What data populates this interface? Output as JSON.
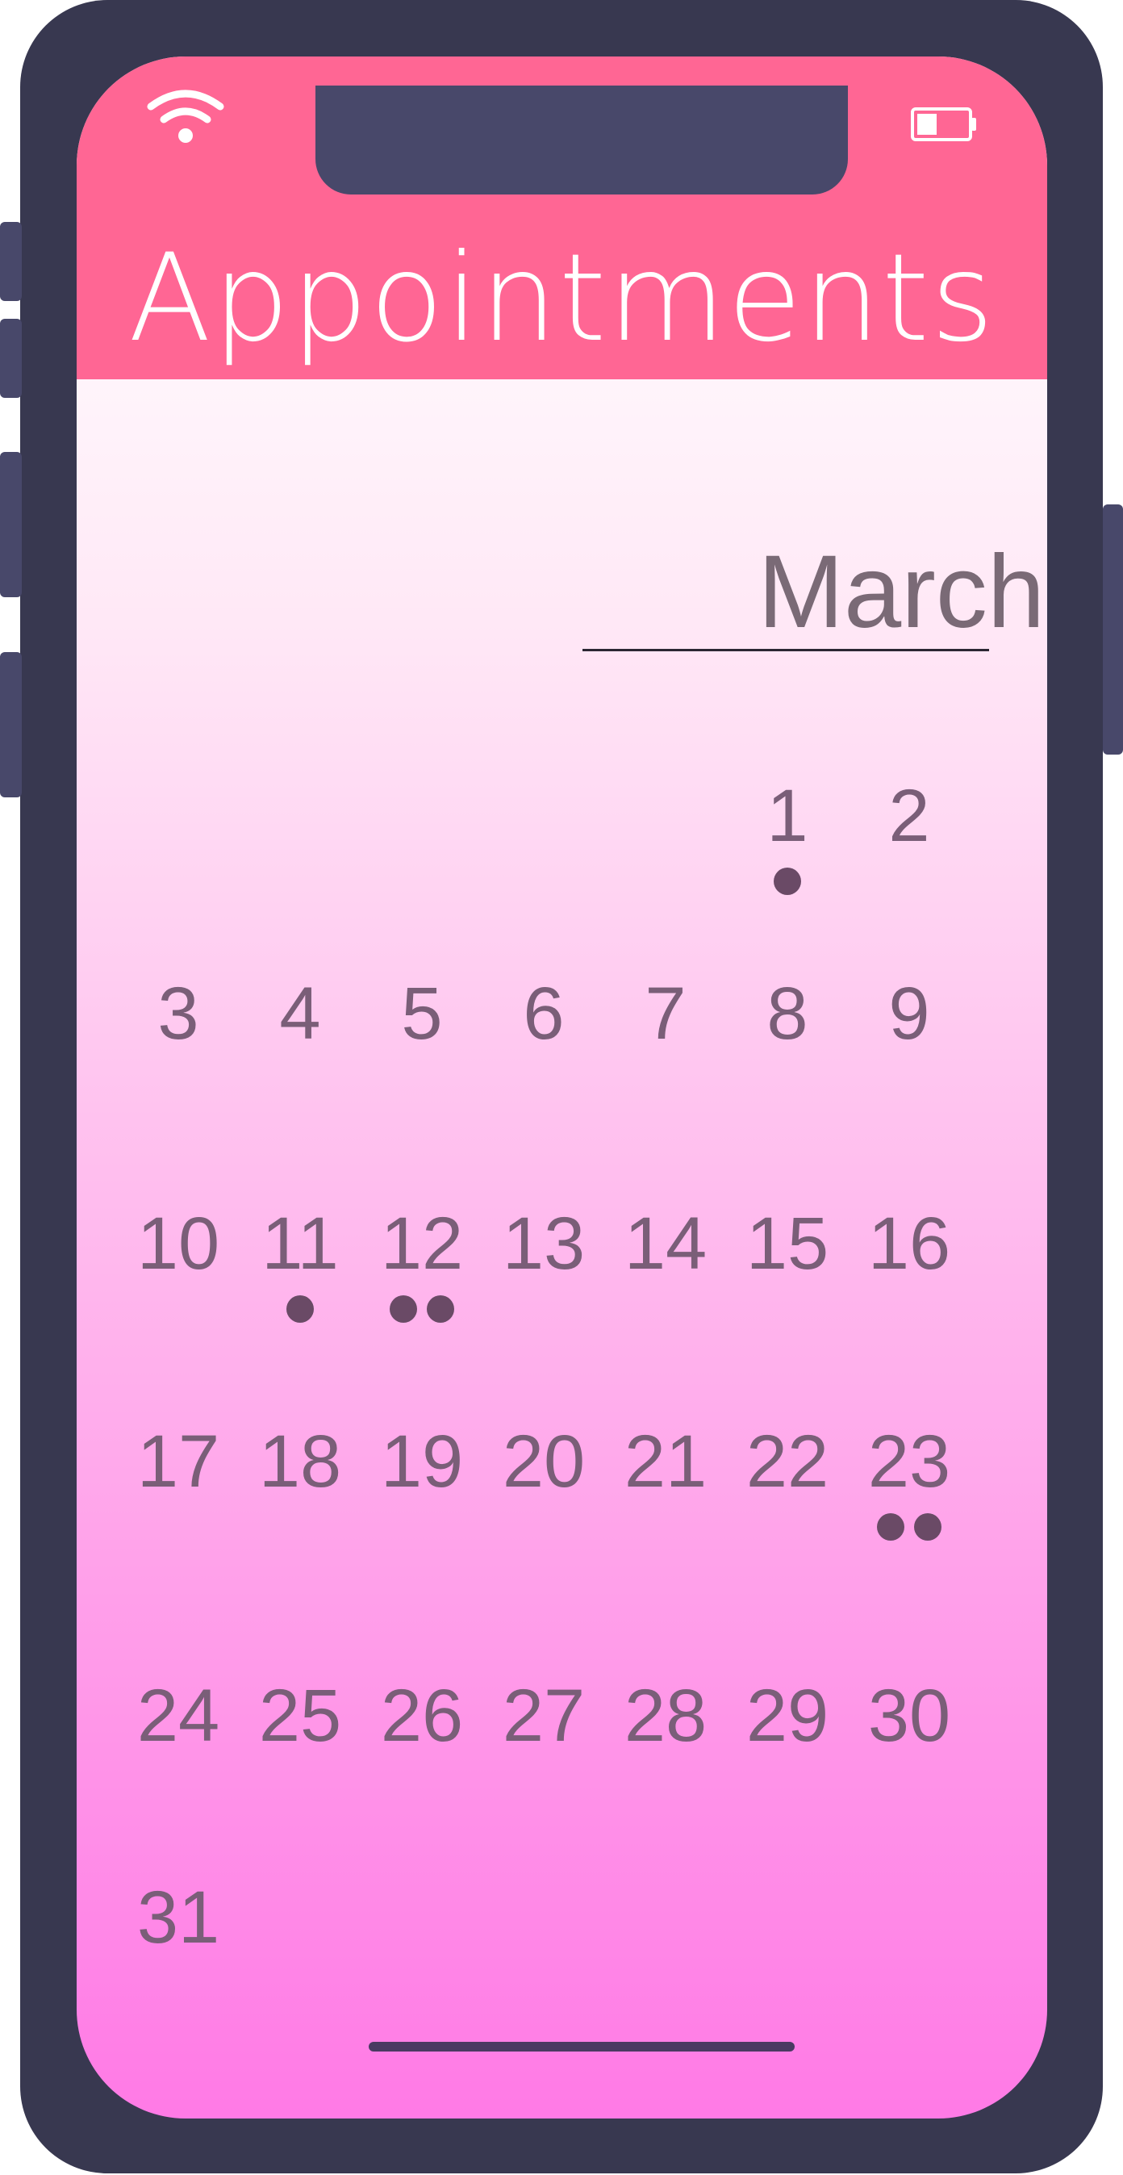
{
  "header": {
    "title": "Appointments",
    "background_color": "#ff6694"
  },
  "status_bar": {
    "wifi_icon": "wifi-icon",
    "battery_icon": "battery-icon",
    "battery_level": 0.4
  },
  "calendar": {
    "month": "March",
    "weeks": [
      [
        {
          "day": ""
        },
        {
          "day": ""
        },
        {
          "day": ""
        },
        {
          "day": ""
        },
        {
          "day": ""
        },
        {
          "day": "1",
          "appointments": 1
        },
        {
          "day": "2",
          "appointments": 0
        }
      ],
      [
        {
          "day": "3",
          "appointments": 0
        },
        {
          "day": "4",
          "appointments": 0
        },
        {
          "day": "5",
          "appointments": 0
        },
        {
          "day": "6",
          "appointments": 0
        },
        {
          "day": "7",
          "appointments": 0
        },
        {
          "day": "8",
          "appointments": 0
        },
        {
          "day": "9",
          "appointments": 0
        }
      ],
      [
        {
          "day": "10",
          "appointments": 0
        },
        {
          "day": "11",
          "appointments": 1
        },
        {
          "day": "12",
          "appointments": 2
        },
        {
          "day": "13",
          "appointments": 0
        },
        {
          "day": "14",
          "appointments": 0
        },
        {
          "day": "15",
          "appointments": 0
        },
        {
          "day": "16",
          "appointments": 0
        }
      ],
      [
        {
          "day": "17",
          "appointments": 0
        },
        {
          "day": "18",
          "appointments": 0
        },
        {
          "day": "19",
          "appointments": 0
        },
        {
          "day": "20",
          "appointments": 0
        },
        {
          "day": "21",
          "appointments": 0
        },
        {
          "day": "22",
          "appointments": 0
        },
        {
          "day": "23",
          "appointments": 2
        }
      ],
      [
        {
          "day": "24",
          "appointments": 0
        },
        {
          "day": "25",
          "appointments": 0
        },
        {
          "day": "26",
          "appointments": 0
        },
        {
          "day": "27",
          "appointments": 0
        },
        {
          "day": "28",
          "appointments": 0
        },
        {
          "day": "29",
          "appointments": 0
        },
        {
          "day": "30",
          "appointments": 0
        }
      ],
      [
        {
          "day": "31",
          "appointments": 0
        }
      ]
    ]
  },
  "colors": {
    "frame": "#383850",
    "day_text": "#7a5e78",
    "appointment_dot": "#6a4a66"
  }
}
